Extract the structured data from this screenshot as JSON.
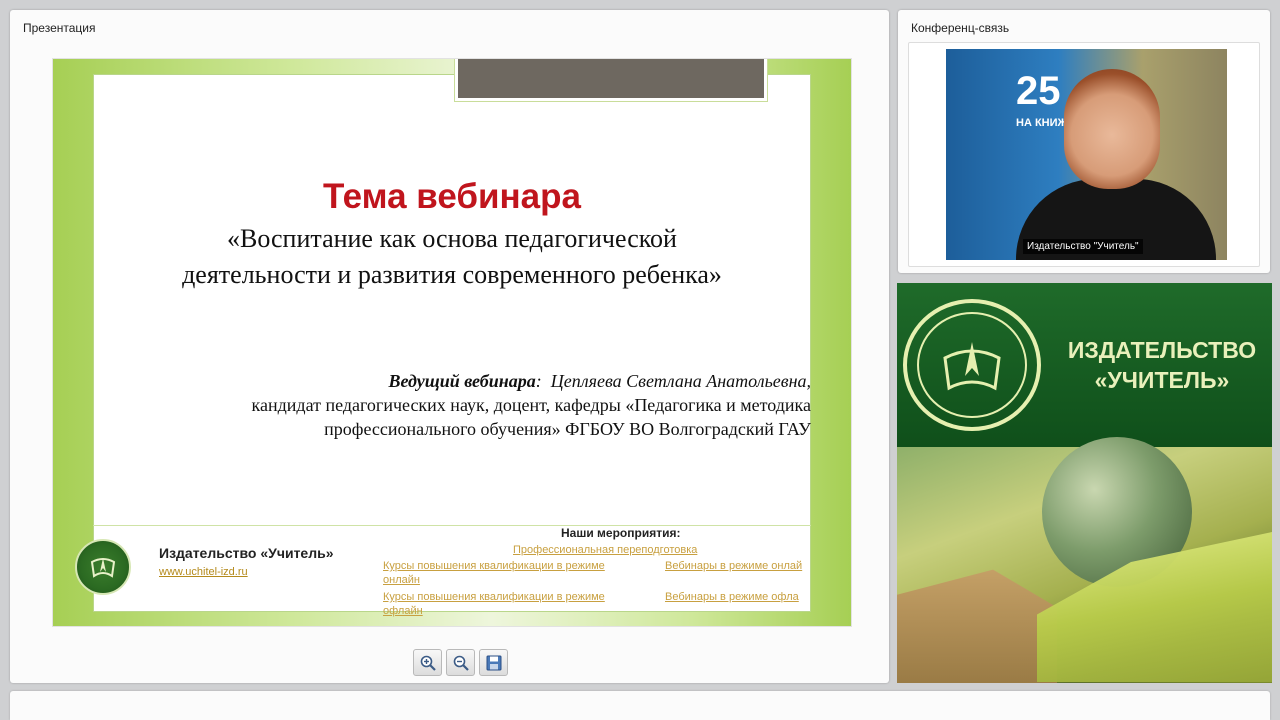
{
  "presentation": {
    "panel_title": "Презентация",
    "slide": {
      "heading": "Тема вебинара",
      "topic_line1": "«Воспитание как основа педагогической",
      "topic_line2": "деятельности и развития современного ребенка»",
      "host_label": "Ведущий вебинара",
      "host_name": "Цепляева Светлана Анатольевна,",
      "host_line2": "кандидат педагогических наук,  доцент, кафедры «Педагогика и методика",
      "host_line3": "профессионального обучения» ФГБОУ ВО Волгоградский ГАУ",
      "footer_company": "Издательство «Учитель»",
      "footer_url": "www.uchitel-izd.ru",
      "events_title": "Наши мероприятия:",
      "events": [
        "Профессиональная переподготовка",
        "Курсы повышения квалификации в режиме онлайн",
        "Вебинары в режиме онлай",
        "Курсы повышения квалификации в режиме офлайн",
        "Вебинары в режиме офла"
      ]
    },
    "toolbar": [
      "zoom-in-icon",
      "zoom-out-icon",
      "save-icon"
    ]
  },
  "conference": {
    "panel_title": "Конференц-связь",
    "video_caption": "Издательство \"Учитель\"",
    "banner_number": "25",
    "banner_text": "НА КНИЖ"
  },
  "publisher_banner": {
    "name_line1": "ИЗДАТЕЛЬСТВО",
    "name_line2": "«УЧИТЕЛЬ»"
  }
}
